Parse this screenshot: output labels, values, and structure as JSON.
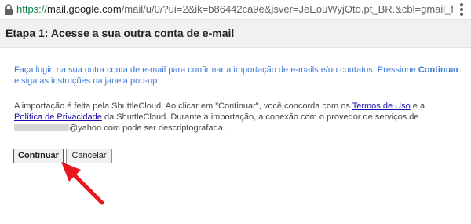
{
  "browser": {
    "url_scheme": "https://",
    "url_host": "mail.google.com",
    "url_rest": "/mail/u/0/?ui=2&ik=b86442ca9e&jsver=JeEouWyjOto.pt_BR.&cbl=gmail_fe_1..."
  },
  "page": {
    "title": "Etapa 1: Acesse a sua outra conta de e-mail"
  },
  "instructions": {
    "part1": "Faça login na sua outra conta de e-mail para confirmar a importação de e-mails e/ou contatos. Pressione",
    "emphasis": "Continuar",
    "part2": "e siga as instruções na janela pop-up."
  },
  "legal": {
    "part1": "A importação é feita pela ShuttleCloud. Ao clicar em \"Continuar\", você concorda com os",
    "terms_link": "Termos de Uso",
    "and": "e a",
    "privacy_link": "Política de Privacidade",
    "part2": "da ShuttleCloud. Durante a importação, a conexão com o provedor de serviços de",
    "email_suffix": "@yahoo.com pode ser descriptografada."
  },
  "buttons": {
    "continue_label": "Continuar",
    "cancel_label": "Cancelar"
  },
  "colors": {
    "annotation_arrow": "#e8171c",
    "instruction_text": "#3c78d8",
    "link": "#1a0dab"
  }
}
